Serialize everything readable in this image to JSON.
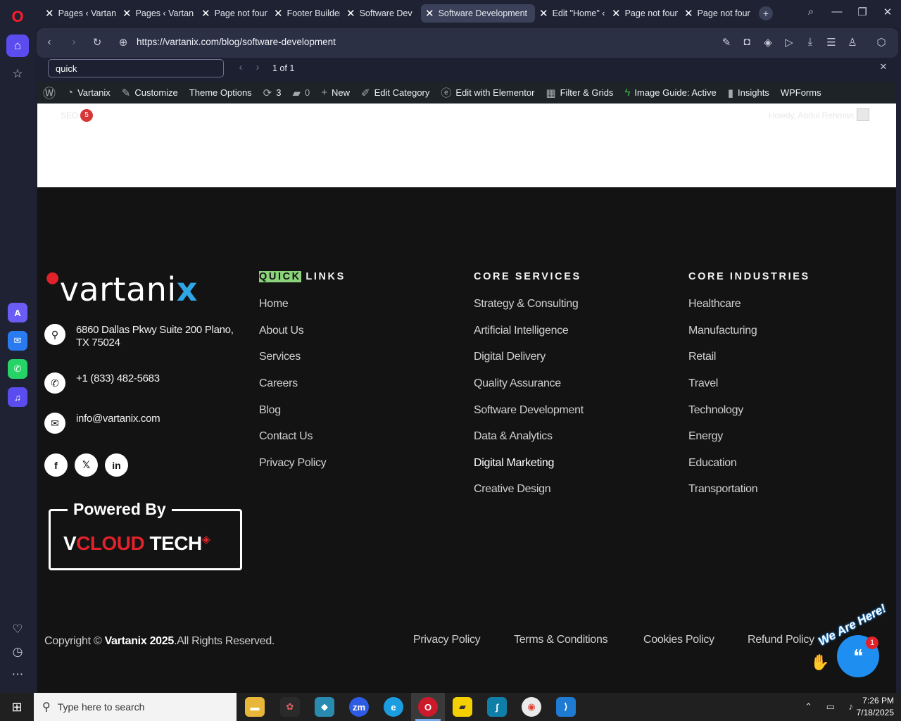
{
  "browser": {
    "tabs": [
      {
        "label": "Pages ‹ Vartan"
      },
      {
        "label": "Pages ‹ Vartan"
      },
      {
        "label": "Page not foun"
      },
      {
        "label": "Footer Builder"
      },
      {
        "label": "Software Deve"
      },
      {
        "label": "Software Development"
      },
      {
        "label": "Edit \"Home\" ‹"
      },
      {
        "label": "Page not foun"
      },
      {
        "label": "Page not foun"
      }
    ],
    "url": "https://vartanix.com/blog/software-development",
    "find": {
      "query": "quick",
      "count": "1 of 1"
    }
  },
  "wp_admin_bar": {
    "site_name": "Vartanix",
    "customize": "Customize",
    "theme_options": "Theme Options",
    "updates_count": "3",
    "comments_count": "0",
    "new_label": "New",
    "edit_category": "Edit Category",
    "elementor": "Edit with Elementor",
    "filter_grids": "Filter & Grids",
    "image_guide": "Image Guide: Active",
    "insights": "Insights",
    "wpforms": "WPForms",
    "seo_label": "SEO",
    "seo_count": "5",
    "howdy": "Howdy, Abdul Rehman"
  },
  "footer": {
    "brand": {
      "pre": "vartani",
      "accent": "x"
    },
    "address": "6860 Dallas Pkwy Suite 200 Plano, TX 75024",
    "phone": "+1 (833) 482-5683",
    "email": "info@vartanix.com",
    "powered_by": "Powered By",
    "vcloud": {
      "v": "V",
      "cloud": "CLOUD",
      "tech": " TECH"
    },
    "quick_links": {
      "title_highlight": "QUICK",
      "title_rest": " LINKS",
      "items": [
        "Home",
        "About Us",
        "Services",
        "Careers",
        "Blog",
        "Contact Us",
        "Privacy Policy"
      ]
    },
    "core_services": {
      "title": "CORE SERVICES",
      "items": [
        "Strategy & Consulting",
        "Artificial Intelligence",
        "Digital Delivery",
        "Quality Assurance",
        "Software Development",
        "Data & Analytics",
        "Digital Marketing",
        "Creative Design"
      ]
    },
    "core_industries": {
      "title": "CORE INDUSTRIES",
      "items": [
        "Healthcare",
        "Manufacturing",
        "Retail",
        "Travel",
        "Technology",
        "Energy",
        "Education",
        "Transportation"
      ]
    },
    "copyright": {
      "pre": "Copyright © ",
      "bold": "Vartanix 2025",
      "post": ".All Rights Reserved."
    },
    "legal_links": [
      "Privacy Policy",
      "Terms & Conditions",
      "Cookies Policy",
      "Refund Policy"
    ],
    "chat": {
      "tagline": "We Are Here!",
      "badge": "1"
    }
  },
  "taskbar": {
    "search_placeholder": "Type here to search",
    "time": "7:26 PM",
    "date": "7/18/2025"
  }
}
